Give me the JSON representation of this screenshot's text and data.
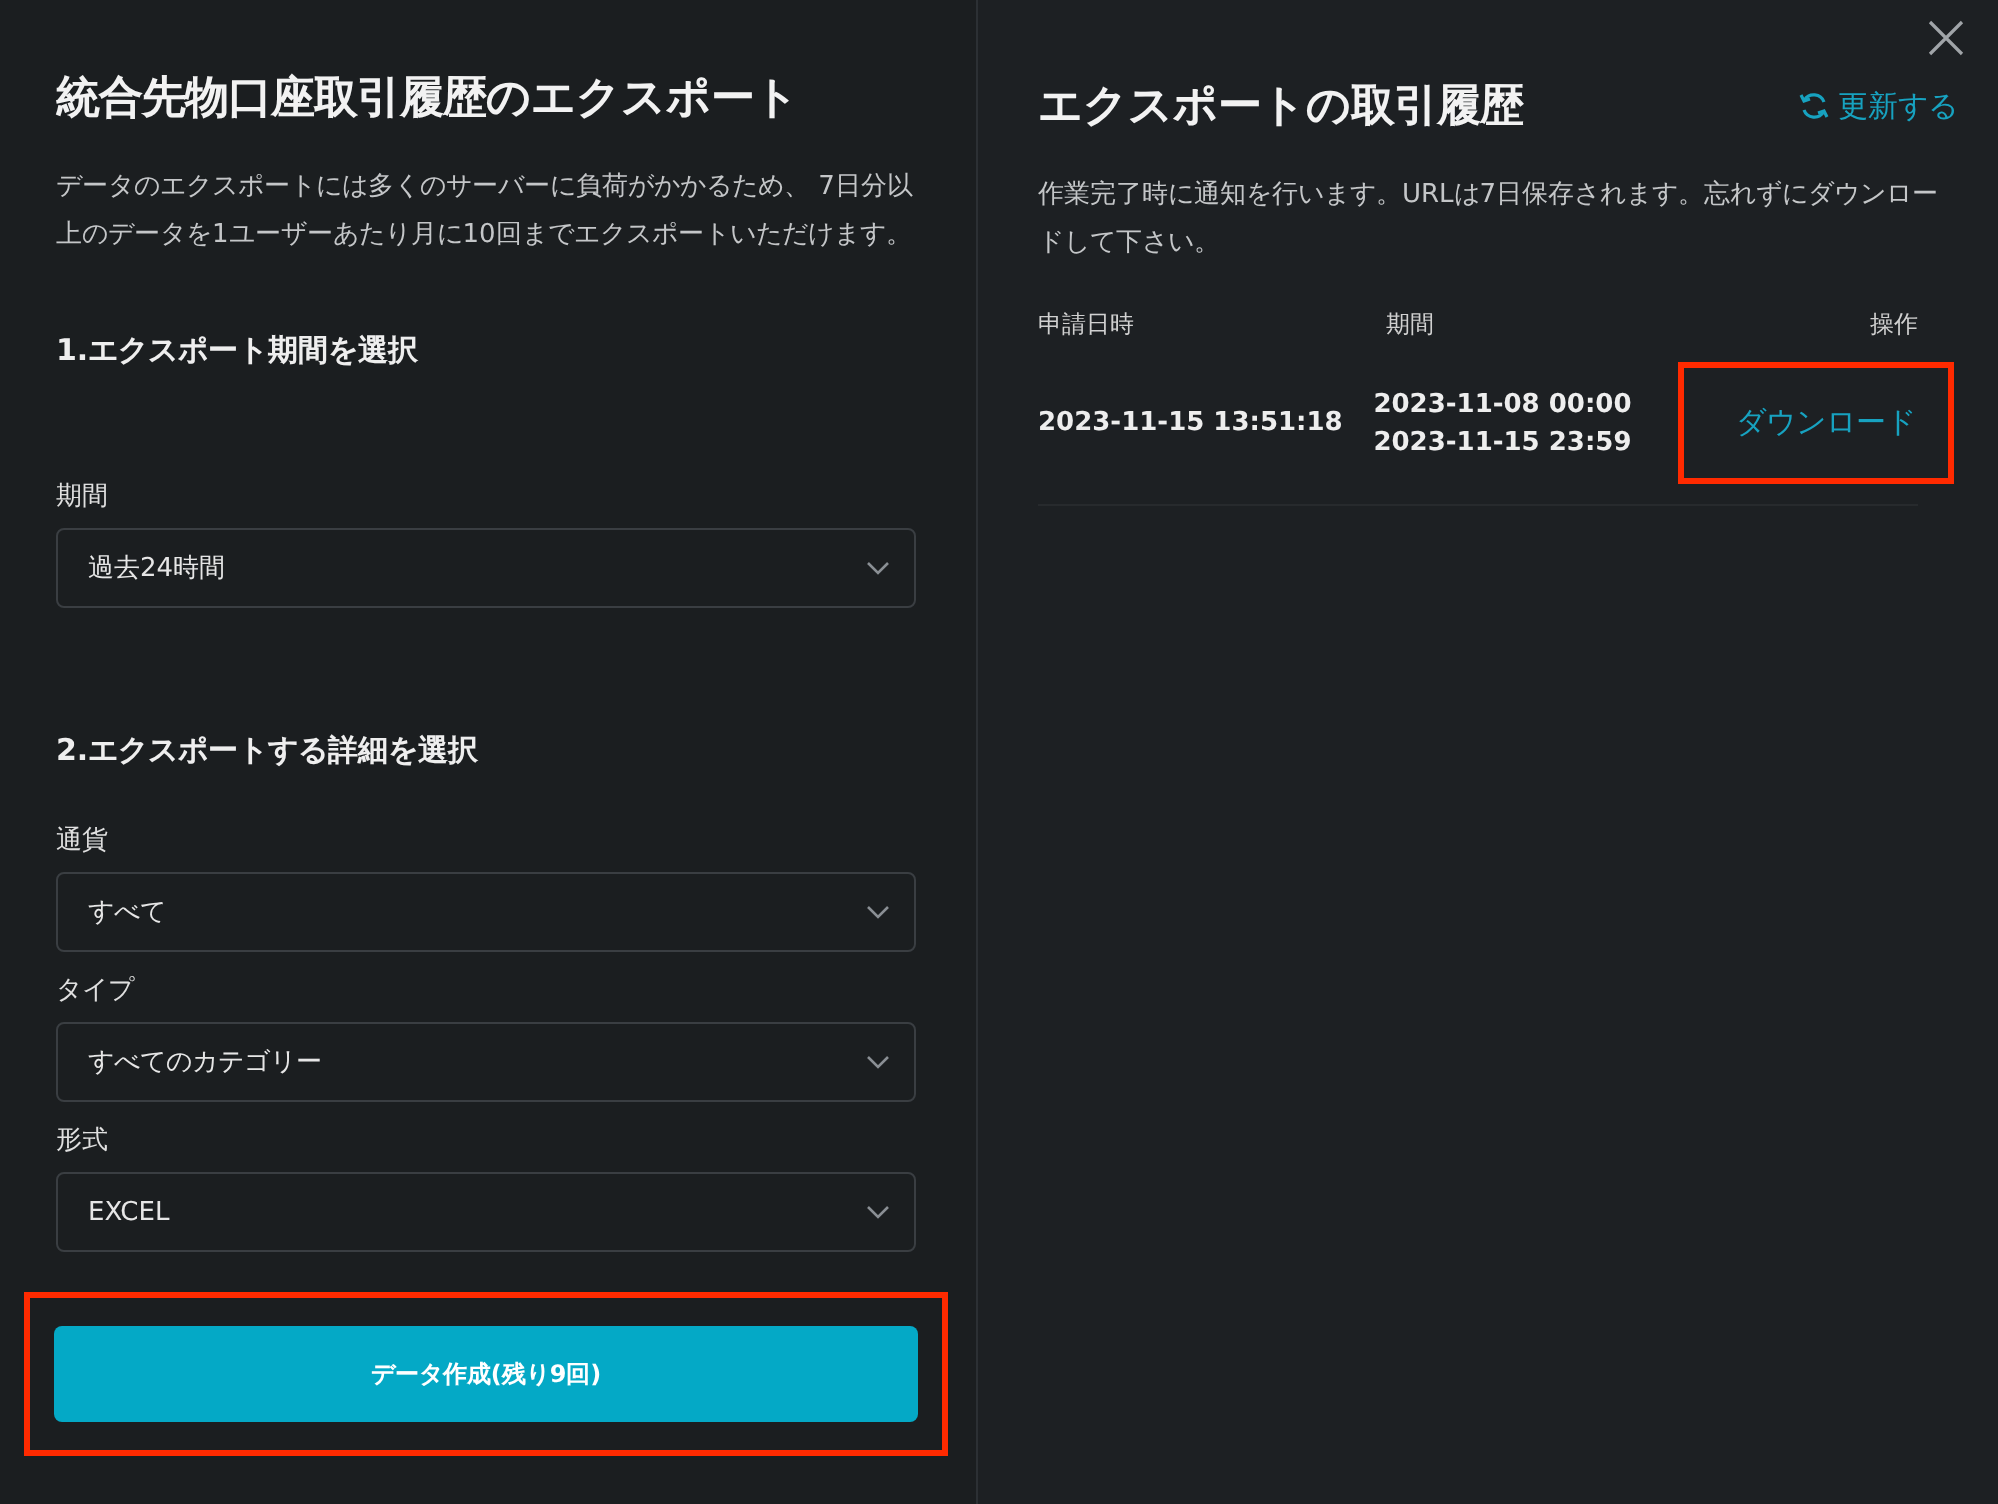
{
  "export_form": {
    "title": "統合先物口座取引履歴のエクスポート",
    "description": "データのエクスポートには多くのサーバーに負荷がかかるため、 7日分以上のデータを1ユーザーあたり月に10回までエクスポートいただけます。",
    "sections": [
      {
        "heading": "1.エクスポート期間を選択",
        "fields": [
          {
            "label": "期間",
            "value": "過去24時間"
          }
        ]
      },
      {
        "heading": "2.エクスポートする詳細を選択",
        "fields": [
          {
            "label": "通貨",
            "value": "すべて"
          },
          {
            "label": "タイプ",
            "value": "すべてのカテゴリー"
          },
          {
            "label": "形式",
            "value": "EXCEL"
          }
        ]
      }
    ],
    "submit_button": {
      "label": "データ作成(残り9回)",
      "highlighted": true
    }
  },
  "history": {
    "title": "エクスポートの取引履歴",
    "refresh_link": "更新する",
    "note": "作業完了時に通知を行います。URLは7日保存されます。忘れずにダウンロードして下さい。",
    "columns": [
      "申請日時",
      "期間",
      "操作"
    ],
    "rows": [
      {
        "requested_at": "2023-11-15 13:51:18",
        "period_start": "2023-11-08 00:00",
        "period_end": "2023-11-15 23:59",
        "action": "ダウンロード",
        "highlighted": true
      }
    ]
  }
}
